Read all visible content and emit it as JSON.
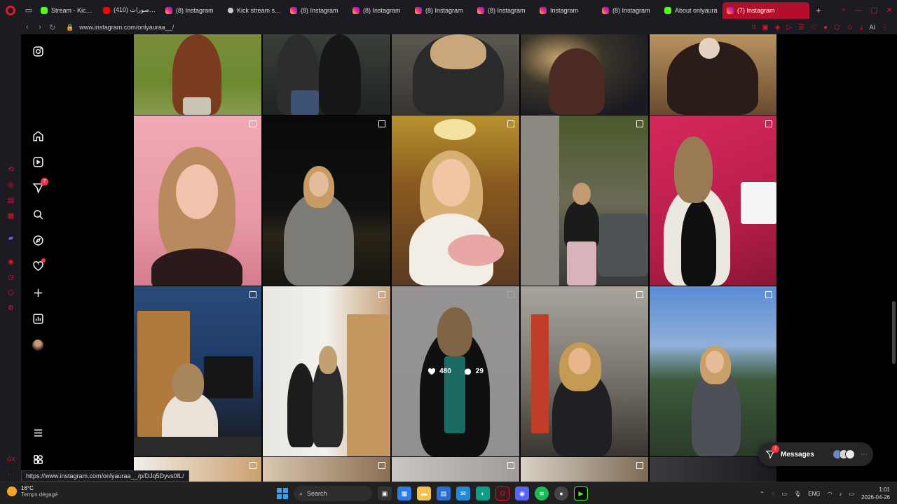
{
  "browser": {
    "tabs": [
      {
        "label": "Stream - Kick D",
        "favicon": "kick"
      },
      {
        "label": "(410) الديناصورات",
        "favicon": "youtube"
      },
      {
        "label": "(8) Instagram",
        "favicon": "instagram"
      },
      {
        "label": "Kick stream sup",
        "favicon": "generic"
      },
      {
        "label": "(8) Instagram",
        "favicon": "instagram"
      },
      {
        "label": "(8) Instagram",
        "favicon": "instagram"
      },
      {
        "label": "(8) Instagram",
        "favicon": "instagram"
      },
      {
        "label": "(8) Instagram",
        "favicon": "instagram"
      },
      {
        "label": "Instagram",
        "favicon": "instagram"
      },
      {
        "label": "(8) Instagram",
        "favicon": "instagram"
      },
      {
        "label": "About onlyaura",
        "favicon": "kick"
      },
      {
        "label": "(7) Instagram",
        "favicon": "instagram",
        "active": true
      }
    ],
    "url": "www.instagram.com/onlyauraa__/",
    "ai_label": "AI",
    "accent": "#e0162b",
    "active_tab_color": "#b30f2d"
  },
  "instagram": {
    "nav": {
      "items": [
        {
          "name": "instagram-logo-icon"
        },
        {
          "name": "home-icon"
        },
        {
          "name": "reels-icon"
        },
        {
          "name": "messages-icon",
          "badge": "7"
        },
        {
          "name": "search-icon"
        },
        {
          "name": "explore-icon"
        },
        {
          "name": "notifications-icon"
        },
        {
          "name": "create-icon"
        },
        {
          "name": "dashboard-icon"
        },
        {
          "name": "profile-avatar"
        },
        {
          "name": "more-menu-icon"
        },
        {
          "name": "also-from-meta-icon"
        }
      ]
    },
    "hover_stats": {
      "likes": "480",
      "comments": "29"
    },
    "messages_pill": {
      "label": "Messages",
      "badge": "7"
    }
  },
  "status_link": "https://www.instagram.com/onlyauraa__/p/DJq5Dyvs0fL/",
  "taskbar": {
    "weather_temp": "16°C",
    "weather_desc": "Temps dégagé",
    "search_placeholder": "Search",
    "language": "ENG",
    "time": "1:01",
    "date": "2026-04-26"
  }
}
